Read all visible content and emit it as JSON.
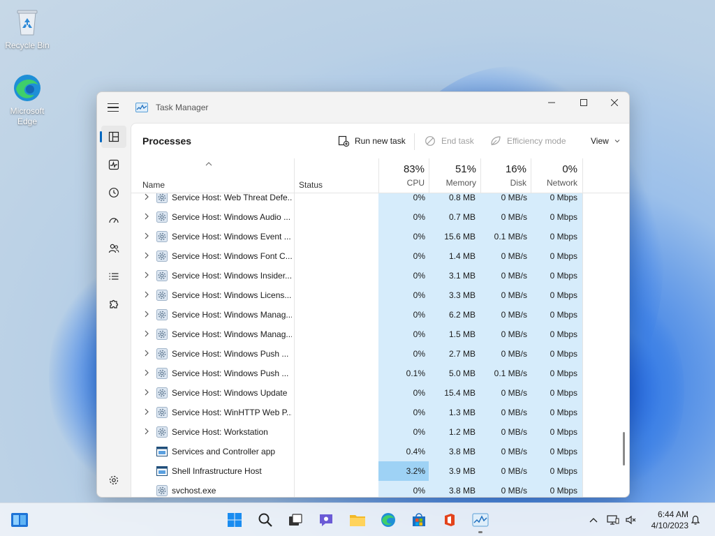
{
  "desktop": {
    "icons": [
      {
        "label": "Recycle Bin"
      },
      {
        "label": "Microsoft Edge"
      }
    ]
  },
  "window": {
    "title": "Task Manager",
    "page_title": "Processes",
    "commands": {
      "run_new_task": "Run new task",
      "end_task": "End task",
      "efficiency_mode": "Efficiency mode",
      "view": "View"
    },
    "columns": {
      "name": "Name",
      "status": "Status",
      "cpu": {
        "pct": "83%",
        "label": "CPU"
      },
      "memory": {
        "pct": "51%",
        "label": "Memory"
      },
      "disk": {
        "pct": "16%",
        "label": "Disk"
      },
      "network": {
        "pct": "0%",
        "label": "Network"
      }
    },
    "rows": [
      {
        "name": "Service Host: Web Threat Defe...",
        "cpu": "0%",
        "mem": "0.8 MB",
        "disk": "0 MB/s",
        "net": "0 Mbps",
        "expandable": true,
        "icon": "gear-icon"
      },
      {
        "name": "Service Host: Windows Audio ...",
        "cpu": "0%",
        "mem": "0.7 MB",
        "disk": "0 MB/s",
        "net": "0 Mbps",
        "expandable": true,
        "icon": "gear-icon"
      },
      {
        "name": "Service Host: Windows Event ...",
        "cpu": "0%",
        "mem": "15.6 MB",
        "disk": "0.1 MB/s",
        "net": "0 Mbps",
        "expandable": true,
        "icon": "gear-icon"
      },
      {
        "name": "Service Host: Windows Font C...",
        "cpu": "0%",
        "mem": "1.4 MB",
        "disk": "0 MB/s",
        "net": "0 Mbps",
        "expandable": true,
        "icon": "gear-icon"
      },
      {
        "name": "Service Host: Windows Insider...",
        "cpu": "0%",
        "mem": "3.1 MB",
        "disk": "0 MB/s",
        "net": "0 Mbps",
        "expandable": true,
        "icon": "gear-icon"
      },
      {
        "name": "Service Host: Windows Licens...",
        "cpu": "0%",
        "mem": "3.3 MB",
        "disk": "0 MB/s",
        "net": "0 Mbps",
        "expandable": true,
        "icon": "gear-icon"
      },
      {
        "name": "Service Host: Windows Manag...",
        "cpu": "0%",
        "mem": "6.2 MB",
        "disk": "0 MB/s",
        "net": "0 Mbps",
        "expandable": true,
        "icon": "gear-icon"
      },
      {
        "name": "Service Host: Windows Manag...",
        "cpu": "0%",
        "mem": "1.5 MB",
        "disk": "0 MB/s",
        "net": "0 Mbps",
        "expandable": true,
        "icon": "gear-icon"
      },
      {
        "name": "Service Host: Windows Push ...",
        "cpu": "0%",
        "mem": "2.7 MB",
        "disk": "0 MB/s",
        "net": "0 Mbps",
        "expandable": true,
        "icon": "gear-icon"
      },
      {
        "name": "Service Host: Windows Push ...",
        "cpu": "0.1%",
        "mem": "5.0 MB",
        "disk": "0.1 MB/s",
        "net": "0 Mbps",
        "expandable": true,
        "icon": "gear-icon"
      },
      {
        "name": "Service Host: Windows Update",
        "cpu": "0%",
        "mem": "15.4 MB",
        "disk": "0 MB/s",
        "net": "0 Mbps",
        "expandable": true,
        "icon": "gear-icon"
      },
      {
        "name": "Service Host: WinHTTP Web P...",
        "cpu": "0%",
        "mem": "1.3 MB",
        "disk": "0 MB/s",
        "net": "0 Mbps",
        "expandable": true,
        "icon": "gear-icon"
      },
      {
        "name": "Service Host: Workstation",
        "cpu": "0%",
        "mem": "1.2 MB",
        "disk": "0 MB/s",
        "net": "0 Mbps",
        "expandable": true,
        "icon": "gear-icon"
      },
      {
        "name": "Services and Controller app",
        "cpu": "0.4%",
        "mem": "3.8 MB",
        "disk": "0 MB/s",
        "net": "0 Mbps",
        "expandable": false,
        "icon": "app-window-icon"
      },
      {
        "name": "Shell Infrastructure Host",
        "cpu": "3.2%",
        "mem": "3.9 MB",
        "disk": "0 MB/s",
        "net": "0 Mbps",
        "expandable": false,
        "icon": "app-window-icon",
        "cpu_hot": true
      },
      {
        "name": "svchost.exe",
        "cpu": "0%",
        "mem": "3.8 MB",
        "disk": "0 MB/s",
        "net": "0 Mbps",
        "expandable": false,
        "icon": "gear-icon"
      }
    ]
  },
  "taskbar": {
    "time": "6:44 AM",
    "date": "4/10/2023"
  },
  "colors": {
    "accent": "#0067c0",
    "heat": "#d6ecfb",
    "heat_hot": "#9ed2f5"
  }
}
